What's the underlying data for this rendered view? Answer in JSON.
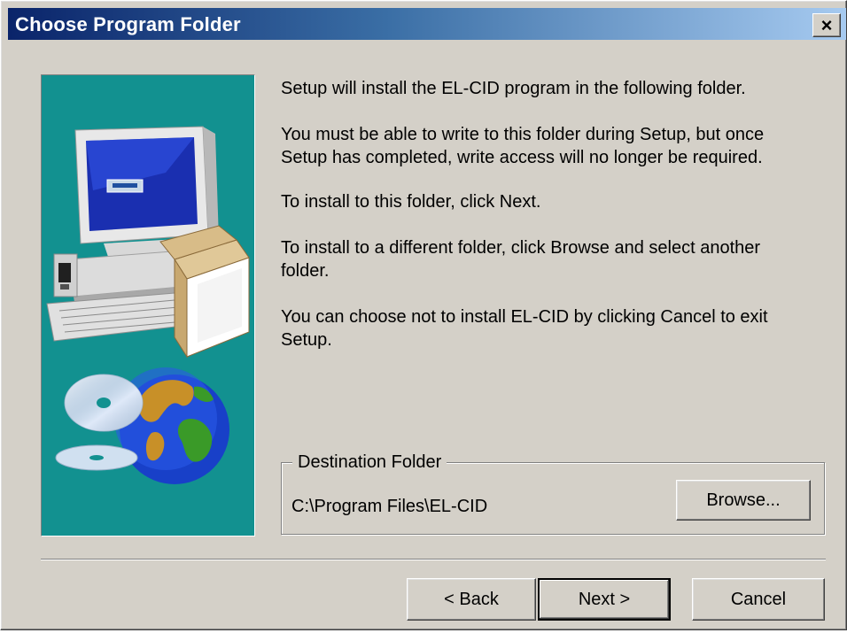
{
  "window": {
    "title": "Choose Program Folder",
    "close_glyph": "×"
  },
  "graphic": {
    "description_icon": "computer-setup-graphic",
    "background_color": "#129190"
  },
  "body": {
    "line1": "Setup will install the EL-CID program in the following folder.",
    "line2a": "You must be able to write to this folder during Setup, but once",
    "line2b": "Setup has completed, write access will no longer be required.",
    "line3": "To install to this folder, click Next.",
    "line4a": "To install to a different folder, click Browse and select another",
    "line4b": "folder.",
    "line5a": "You can choose not to install EL-CID by clicking Cancel to exit",
    "line5b": "Setup."
  },
  "destination": {
    "label": "Destination Folder",
    "path": "C:\\Program Files\\EL-CID",
    "browse_label": "Browse..."
  },
  "buttons": {
    "back": "< Back",
    "next": "Next >",
    "cancel": "Cancel"
  }
}
